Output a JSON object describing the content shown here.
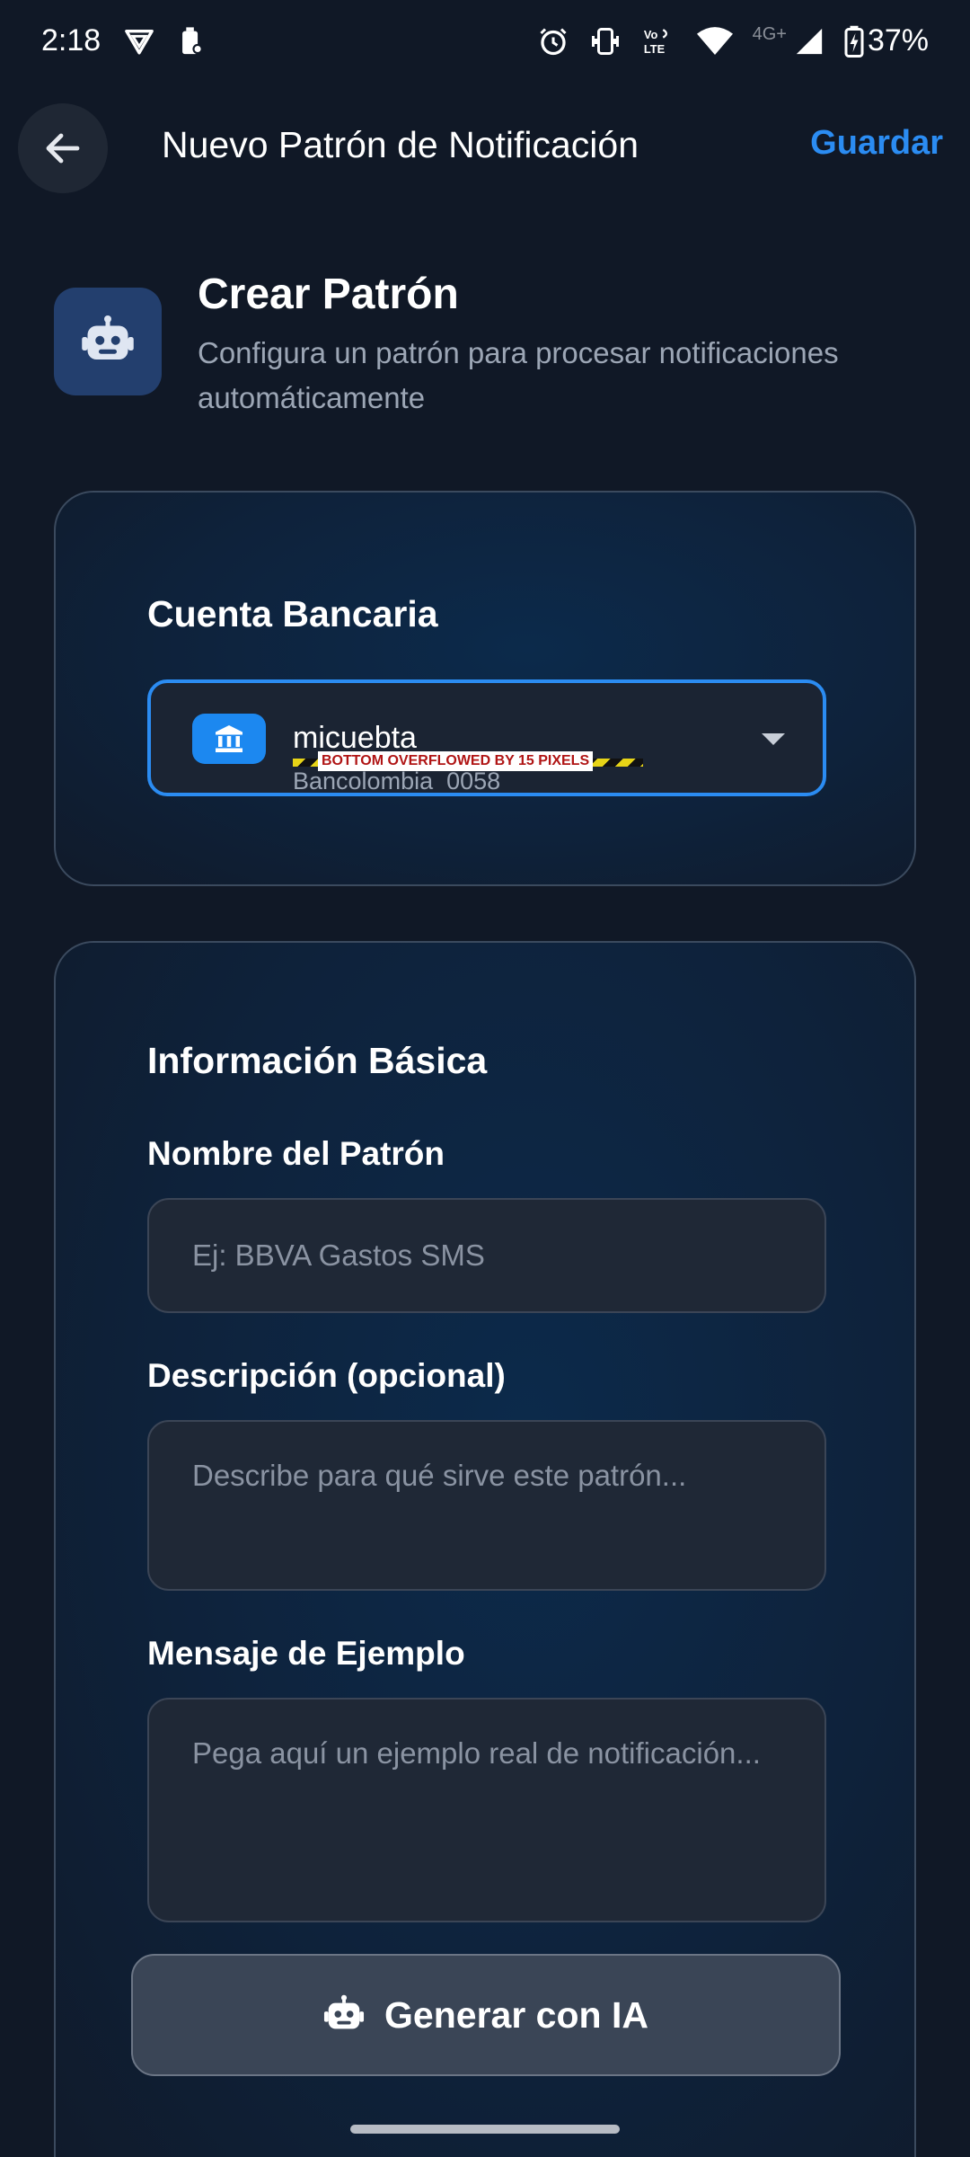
{
  "status_bar": {
    "time": "2:18",
    "network_label": "4G+",
    "volte_label": "Vo LTE",
    "battery_percent": "37%"
  },
  "app_bar": {
    "title": "Nuevo Patrón de Notificación",
    "save_label": "Guardar"
  },
  "header": {
    "title": "Crear Patrón",
    "subtitle": "Configura un patrón para procesar notificaciones automáticamente",
    "icon": "robot-icon"
  },
  "bank_card": {
    "title": "Cuenta Bancaria",
    "selected_account_name": "micuebta",
    "selected_account_detail": "Bancolombia  0058",
    "overflow_warning": "BOTTOM OVERFLOWED BY 15 PIXELS",
    "icon": "bank-icon"
  },
  "basic_card": {
    "title": "Información Básica",
    "name_label": "Nombre del Patrón",
    "name_placeholder": "Ej: BBVA Gastos SMS",
    "description_label": "Descripción (opcional)",
    "description_placeholder": "Describe para qué sirve este patrón...",
    "example_label": "Mensaje de Ejemplo",
    "example_placeholder": "Pega aquí un ejemplo real de notificación...",
    "generate_label": "Generar con IA"
  },
  "colors": {
    "background": "#101826",
    "accent": "#2b8cf2",
    "card_border": "#3b4a5e",
    "field_background": "#1f2836"
  }
}
